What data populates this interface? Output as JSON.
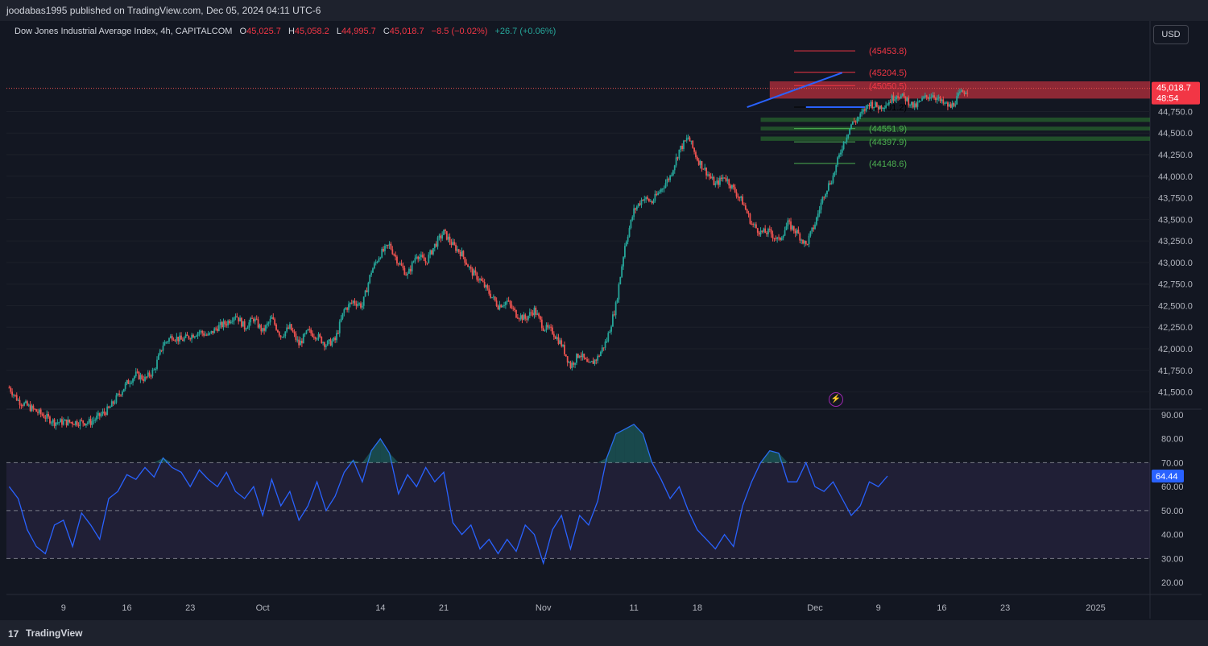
{
  "header": {
    "publisher": "joodabas1995 published on TradingView.com, Dec 05, 2024 04:11 UTC-6"
  },
  "legend": {
    "symbol": "Dow Jones Industrial Average Index, 4h, CAPITALCOM",
    "o_label": "O",
    "o": "45,025.7",
    "h_label": "H",
    "h": "45,058.2",
    "l_label": "L",
    "l": "44,995.7",
    "c_label": "C",
    "c": "45,018.7",
    "chg": "−8.5 (−0.02%)",
    "extra": "+26.7 (+0.06%)"
  },
  "currency_button": "USD",
  "footer": {
    "brand": "TradingView",
    "logo": "17"
  },
  "colors": {
    "bg": "#131722",
    "up": "#26a69a",
    "down": "#ef5350",
    "rsi": "#2962ff",
    "grid": "#1e222d"
  },
  "chart_data": [
    {
      "type": "candlestick",
      "title": "Dow Jones Industrial Average Index, 4h, CAPITALCOM",
      "ylim": [
        41300,
        45800
      ],
      "y_ticks": [
        "41,500.0",
        "41,750.0",
        "42,000.0",
        "42,250.0",
        "42,500.0",
        "42,750.0",
        "43,000.0",
        "43,250.0",
        "43,500.0",
        "43,750.0",
        "44,000.0",
        "44,250.0",
        "44,500.0",
        "44,750.0"
      ],
      "y_tick_values": [
        41500,
        41750,
        42000,
        42250,
        42500,
        42750,
        43000,
        43250,
        43500,
        43750,
        44000,
        44250,
        44500,
        44750
      ],
      "x_ticks": [
        "9",
        "16",
        "23",
        "Oct",
        "14",
        "21",
        "Nov",
        "11",
        "18",
        "Dec",
        "9",
        "16",
        "23",
        "2025"
      ],
      "x_tick_days": [
        9,
        16,
        23,
        31,
        44,
        51,
        62,
        72,
        79,
        92,
        99,
        106,
        113,
        123
      ],
      "x_range_days": [
        2.7,
        129
      ],
      "last_day": 97.5,
      "last_price": "45,018.7",
      "countdown": "48:54",
      "last_price_value": 45018.7,
      "price_path": [
        [
          3,
          41550
        ],
        [
          4,
          41400
        ],
        [
          8,
          41150
        ],
        [
          12,
          41150
        ],
        [
          14,
          41300
        ],
        [
          15,
          41450
        ],
        [
          16,
          41600
        ],
        [
          17,
          41700
        ],
        [
          18,
          41650
        ],
        [
          19,
          41750
        ],
        [
          20,
          42050
        ],
        [
          21,
          42150
        ],
        [
          22,
          42100
        ],
        [
          23,
          42150
        ],
        [
          24,
          42200
        ],
        [
          25,
          42150
        ],
        [
          26,
          42250
        ],
        [
          27,
          42300
        ],
        [
          28,
          42400
        ],
        [
          29,
          42250
        ],
        [
          30,
          42350
        ],
        [
          31,
          42200
        ],
        [
          32,
          42350
        ],
        [
          33,
          42150
        ],
        [
          34,
          42250
        ],
        [
          35,
          42050
        ],
        [
          36,
          42200
        ],
        [
          37,
          42150
        ],
        [
          38,
          42050
        ],
        [
          39,
          42100
        ],
        [
          40,
          42450
        ],
        [
          41,
          42550
        ],
        [
          42,
          42500
        ],
        [
          43,
          42900
        ],
        [
          44,
          43100
        ],
        [
          45,
          43200
        ],
        [
          46,
          43000
        ],
        [
          47,
          42850
        ],
        [
          48,
          43100
        ],
        [
          49,
          43000
        ],
        [
          50,
          43200
        ],
        [
          51,
          43350
        ],
        [
          52,
          43200
        ],
        [
          53,
          43100
        ],
        [
          54,
          42900
        ],
        [
          55,
          42800
        ],
        [
          56,
          42650
        ],
        [
          57,
          42500
        ],
        [
          58,
          42550
        ],
        [
          59,
          42400
        ],
        [
          60,
          42350
        ],
        [
          61,
          42450
        ],
        [
          62,
          42250
        ],
        [
          63,
          42200
        ],
        [
          64,
          42050
        ],
        [
          65,
          41800
        ],
        [
          66,
          41950
        ],
        [
          67,
          41800
        ],
        [
          68,
          41900
        ],
        [
          69,
          42100
        ],
        [
          70,
          42500
        ],
        [
          71,
          43200
        ],
        [
          72,
          43600
        ],
        [
          73,
          43750
        ],
        [
          74,
          43700
        ],
        [
          75,
          43850
        ],
        [
          76,
          44000
        ],
        [
          77,
          44300
        ],
        [
          78,
          44450
        ],
        [
          79,
          44200
        ],
        [
          80,
          44050
        ],
        [
          81,
          43900
        ],
        [
          82,
          44000
        ],
        [
          83,
          43850
        ],
        [
          84,
          43700
        ],
        [
          85,
          43450
        ],
        [
          86,
          43350
        ],
        [
          87,
          43350
        ],
        [
          88,
          43250
        ],
        [
          89,
          43450
        ],
        [
          90,
          43350
        ],
        [
          91,
          43200
        ],
        [
          92,
          43450
        ],
        [
          93,
          43800
        ],
        [
          94,
          44000
        ],
        [
          95,
          44350
        ],
        [
          96,
          44600
        ],
        [
          97,
          44700
        ],
        [
          98,
          44850
        ],
        [
          99,
          44800
        ],
        [
          100,
          44850
        ],
        [
          101,
          44950
        ],
        [
          102,
          44900
        ],
        [
          103,
          44800
        ],
        [
          104,
          44900
        ],
        [
          105,
          44950
        ],
        [
          106,
          44850
        ],
        [
          107,
          44800
        ],
        [
          108,
          44950
        ],
        [
          109,
          45018
        ]
      ],
      "levels": [
        {
          "label": "(45453.8)",
          "value": 45453.8,
          "color": "#f23645"
        },
        {
          "label": "(45204.5)",
          "value": 45204.5,
          "color": "#f23645"
        },
        {
          "label": "(45050.5)",
          "value": 45050.5,
          "color": "#f23645"
        },
        {
          "label": "(44801.2)",
          "value": 44801.2,
          "color": "#000000"
        },
        {
          "label": "(44551.9)",
          "value": 44551.9,
          "color": "#4caf50"
        },
        {
          "label": "(44397.9)",
          "value": 44397.9,
          "color": "#4caf50"
        },
        {
          "label": "(44148.6)",
          "value": 44148.6,
          "color": "#4caf50"
        }
      ],
      "zones": [
        {
          "from_day": 87,
          "to_day": 129,
          "low": 44900,
          "high": 45100,
          "color": "#f23645"
        },
        {
          "from_day": 86,
          "to_day": 129,
          "low": 44630,
          "high": 44680,
          "color": "#2e7d32"
        },
        {
          "from_day": 86,
          "to_day": 129,
          "low": 44530,
          "high": 44575,
          "color": "#2e7d32"
        },
        {
          "from_day": 86,
          "to_day": 129,
          "low": 44410,
          "high": 44460,
          "color": "#2e7d32"
        }
      ],
      "trendlines": [
        {
          "from": [
            84.5,
            44800
          ],
          "to": [
            95,
            45200
          ],
          "color": "#2962ff"
        },
        {
          "from": [
            91,
            44801
          ],
          "to": [
            97.5,
            44801
          ],
          "color": "#2962ff"
        }
      ]
    },
    {
      "type": "line",
      "title": "RSI",
      "ylim": [
        15,
        92
      ],
      "y_ticks": [
        "20.00",
        "30.00",
        "40.00",
        "50.00",
        "60.00",
        "70.00",
        "80.00",
        "90.00"
      ],
      "y_tick_values": [
        20,
        30,
        40,
        50,
        60,
        70,
        80,
        90
      ],
      "band": [
        30,
        70
      ],
      "midline": 50,
      "last_value": "64.44",
      "last_value_num": 64.44,
      "series": [
        [
          3,
          60
        ],
        [
          4,
          55
        ],
        [
          5,
          42
        ],
        [
          6,
          35
        ],
        [
          7,
          32
        ],
        [
          8,
          44
        ],
        [
          9,
          46
        ],
        [
          10,
          35
        ],
        [
          11,
          49
        ],
        [
          12,
          44
        ],
        [
          13,
          38
        ],
        [
          14,
          55
        ],
        [
          15,
          58
        ],
        [
          16,
          65
        ],
        [
          17,
          63
        ],
        [
          18,
          68
        ],
        [
          19,
          64
        ],
        [
          20,
          72
        ],
        [
          21,
          68
        ],
        [
          22,
          66
        ],
        [
          23,
          60
        ],
        [
          24,
          67
        ],
        [
          25,
          63
        ],
        [
          26,
          60
        ],
        [
          27,
          66
        ],
        [
          28,
          58
        ],
        [
          29,
          55
        ],
        [
          30,
          60
        ],
        [
          31,
          48
        ],
        [
          32,
          63
        ],
        [
          33,
          52
        ],
        [
          34,
          58
        ],
        [
          35,
          46
        ],
        [
          36,
          52
        ],
        [
          37,
          62
        ],
        [
          38,
          50
        ],
        [
          39,
          56
        ],
        [
          40,
          66
        ],
        [
          41,
          71
        ],
        [
          42,
          62
        ],
        [
          43,
          75
        ],
        [
          44,
          80
        ],
        [
          45,
          74
        ],
        [
          46,
          57
        ],
        [
          47,
          65
        ],
        [
          48,
          60
        ],
        [
          49,
          68
        ],
        [
          50,
          62
        ],
        [
          51,
          66
        ],
        [
          52,
          45
        ],
        [
          53,
          40
        ],
        [
          54,
          44
        ],
        [
          55,
          34
        ],
        [
          56,
          38
        ],
        [
          57,
          32
        ],
        [
          58,
          38
        ],
        [
          59,
          33
        ],
        [
          60,
          44
        ],
        [
          61,
          40
        ],
        [
          62,
          28
        ],
        [
          63,
          42
        ],
        [
          64,
          48
        ],
        [
          65,
          34
        ],
        [
          66,
          48
        ],
        [
          67,
          44
        ],
        [
          68,
          54
        ],
        [
          69,
          72
        ],
        [
          70,
          82
        ],
        [
          71,
          84
        ],
        [
          72,
          86
        ],
        [
          73,
          82
        ],
        [
          74,
          70
        ],
        [
          75,
          63
        ],
        [
          76,
          55
        ],
        [
          77,
          60
        ],
        [
          78,
          50
        ],
        [
          79,
          42
        ],
        [
          80,
          38
        ],
        [
          81,
          34
        ],
        [
          82,
          40
        ],
        [
          83,
          35
        ],
        [
          84,
          52
        ],
        [
          85,
          62
        ],
        [
          86,
          70
        ],
        [
          87,
          75
        ],
        [
          88,
          74
        ],
        [
          89,
          62
        ],
        [
          90,
          62
        ],
        [
          91,
          70
        ],
        [
          92,
          60
        ],
        [
          93,
          58
        ],
        [
          94,
          62
        ],
        [
          95,
          55
        ],
        [
          96,
          48
        ],
        [
          97,
          52
        ],
        [
          98,
          62
        ],
        [
          99,
          60
        ],
        [
          100,
          64.44
        ]
      ]
    }
  ]
}
